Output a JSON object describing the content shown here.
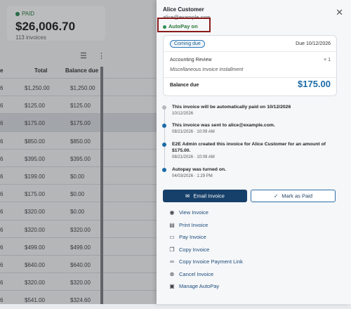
{
  "summary": {
    "status": "PAID",
    "amount": "$26,006.70",
    "count": "113 invoices"
  },
  "table": {
    "headers": {
      "partial": "e",
      "total": "Total",
      "balance": "Balance due"
    },
    "rows": [
      {
        "partial": "6",
        "total": "$1,250.00",
        "balance": "$1,250.00"
      },
      {
        "partial": "6",
        "total": "$125.00",
        "balance": "$125.00"
      },
      {
        "partial": "6",
        "total": "$175.00",
        "balance": "$175.00"
      },
      {
        "partial": "6",
        "total": "$850.00",
        "balance": "$850.00"
      },
      {
        "partial": "6",
        "total": "$395.00",
        "balance": "$395.00"
      },
      {
        "partial": "6",
        "total": "$199.00",
        "balance": "$0.00"
      },
      {
        "partial": "6",
        "total": "$175.00",
        "balance": "$0.00"
      },
      {
        "partial": "6",
        "total": "$320.00",
        "balance": "$0.00"
      },
      {
        "partial": "6",
        "total": "$320.00",
        "balance": "$320.00"
      },
      {
        "partial": "6",
        "total": "$499.00",
        "balance": "$499.00"
      },
      {
        "partial": "6",
        "total": "$640.00",
        "balance": "$640.00"
      },
      {
        "partial": "6",
        "total": "$320.00",
        "balance": "$320.00"
      },
      {
        "partial": "6",
        "total": "$541.00",
        "balance": "$324.60"
      }
    ]
  },
  "drawer": {
    "customer_name": "Alice Customer",
    "customer_email": "alice@example.com",
    "autopay": "AutoPay on",
    "card": {
      "badge": "Coming due",
      "due": "Due 10/12/2026",
      "item_name": "Accounting Review",
      "item_qty": "× 1",
      "item_desc": "Miscellaneous Invoice Installment",
      "balance_label": "Balance due",
      "balance_amount": "$175.00"
    },
    "timeline": [
      {
        "text": "This invoice will be automatically paid on 10/12/2026",
        "time": "10/12/2026",
        "state": "pending"
      },
      {
        "text": "This invoice was sent to alice@example.com.",
        "time": "08/21/2026 · 10:09 AM",
        "state": "done"
      },
      {
        "text": "E2E Admin created this invoice for Alice Customer for an amount of $175.00.",
        "time": "08/21/2026 · 10:09 AM",
        "state": "done"
      },
      {
        "text": "Autopay was turned on.",
        "time": "04/03/2026 · 1:29 PM",
        "state": "done"
      }
    ],
    "buttons": {
      "email": "Email Invoice",
      "mark_paid": "Mark as Paid"
    },
    "actions": [
      {
        "label": "View Invoice",
        "icon": "eye-icon"
      },
      {
        "label": "Print Invoice",
        "icon": "printer-icon"
      },
      {
        "label": "Pay Invoice",
        "icon": "card-icon"
      },
      {
        "label": "Copy Invoice",
        "icon": "copy-icon"
      },
      {
        "label": "Copy Invoice Payment Link",
        "icon": "link-icon"
      },
      {
        "label": "Cancel Invoice",
        "icon": "cancel-icon"
      },
      {
        "label": "Manage AutoPay",
        "icon": "autopay-icon"
      }
    ]
  },
  "colors": {
    "accent": "#1b6ba8",
    "primary_button": "#16406a",
    "paid_green": "#2e8b57",
    "highlight_border": "#8b1a1a"
  }
}
